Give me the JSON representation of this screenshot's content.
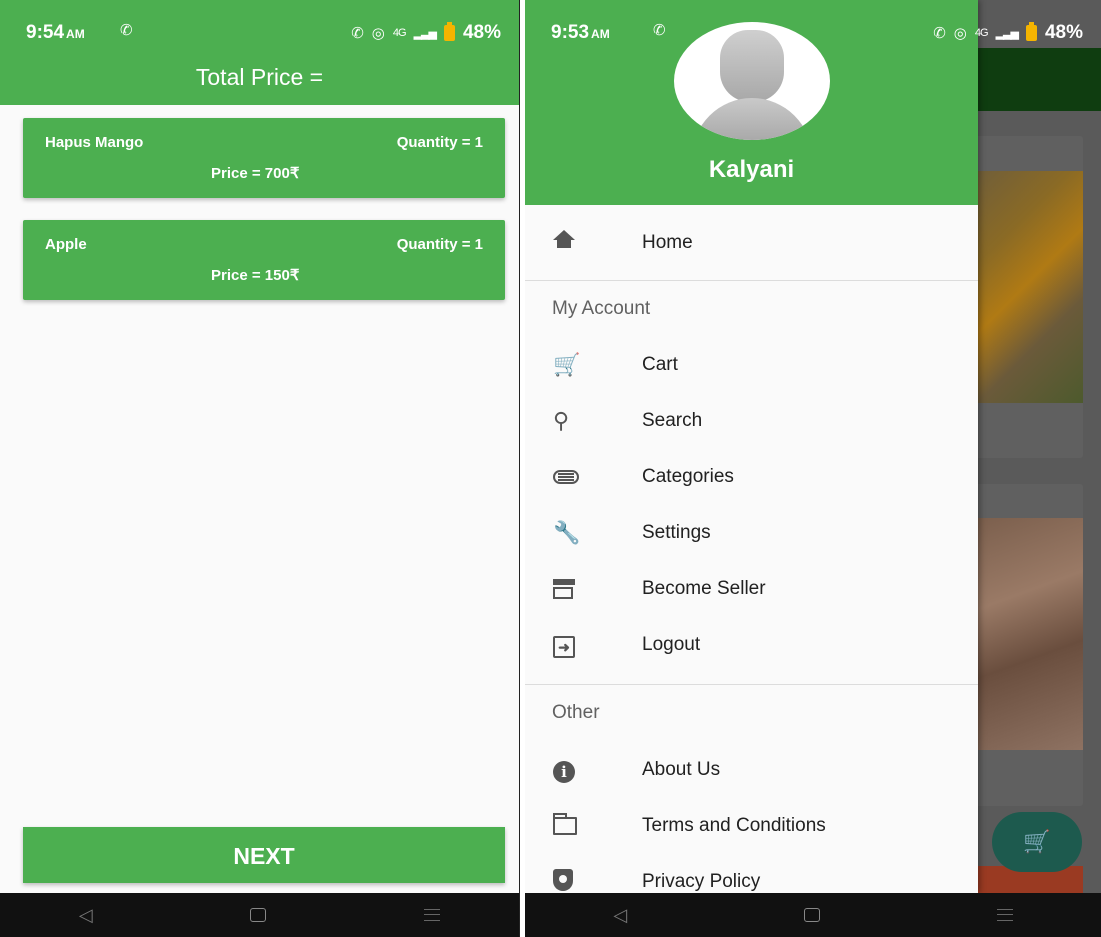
{
  "left": {
    "status": {
      "time": "9:54",
      "ampm": "AM",
      "network": "4G",
      "battery": "48%"
    },
    "title": "Total Price =",
    "cart_items": [
      {
        "name": "Hapus Mango",
        "quantity": "Quantity = 1",
        "price": "Price = 700₹"
      },
      {
        "name": "Apple",
        "quantity": "Quantity = 1",
        "price": "Price = 150₹"
      }
    ],
    "next_label": "NEXT"
  },
  "right": {
    "status": {
      "time": "9:53",
      "ampm": "AM",
      "network": "4G",
      "battery": "48%"
    },
    "drawer": {
      "user_name": "Kalyani",
      "home_label": "Home",
      "account_section": "My Account",
      "account_items": [
        "Cart",
        "Search",
        "Categories",
        "Settings",
        "Become Seller",
        "Logout"
      ],
      "other_section": "Other",
      "other_items": [
        "About Us",
        "Terms and Conditions",
        "Privacy Policy"
      ]
    }
  },
  "colors": {
    "primary": "#4caf50",
    "dark_primary": "#0f3d10",
    "fab": "#1d5a4e"
  }
}
